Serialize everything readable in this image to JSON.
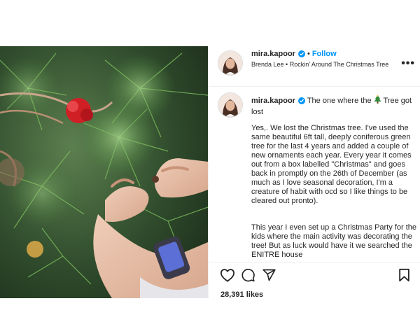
{
  "header": {
    "username": "mira.kapoor",
    "separator": "•",
    "follow_label": "Follow",
    "music": "Brenda Lee • Rockin' Around The Christmas Tree"
  },
  "caption": {
    "username": "mira.kapoor",
    "title_before": "The one where the",
    "title_emoji": "christmas-tree-icon",
    "title_after": "Tree got lost",
    "paragraph_1": "Yes,. We lost the Christmas tree. I've used the same beautiful 6ft tall, deeply coniferous green tree for the last 4 years and added a couple of new ornaments each year. Every year it comes out from a box labelled \"Christmas\" and goes back in promptly on the 26th of December (as much as I love seasonal decoration, I'm a creature of habit with ocd so I like things to be cleared out pronto).",
    "paragraph_2": "This year I even set up a Christmas Party for the kids where the main activity was decorating the tree! But as luck would have it we searched the ENITRE house"
  },
  "actions": {
    "icons": [
      "heart-icon",
      "comment-icon",
      "share-icon",
      "bookmark-icon"
    ],
    "likes": "28,391 likes"
  },
  "colors": {
    "follow": "#0095f6",
    "verified": "#0095f6",
    "text": "#262626"
  }
}
